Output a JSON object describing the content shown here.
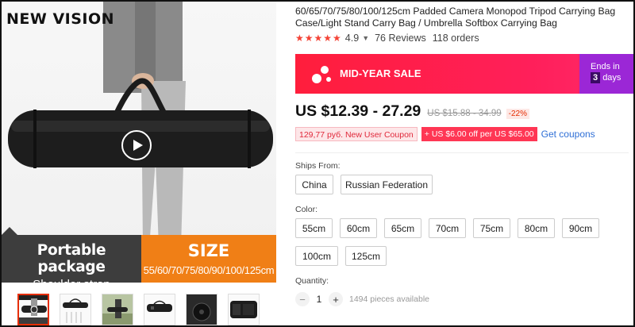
{
  "gallery": {
    "brand": "NEW VISION",
    "banner": {
      "title": "Portable package",
      "subtitle": "Shoulder strap",
      "size_heading": "SIZE",
      "sizes": "55/60/70/75/80/90/100/125cm"
    },
    "thumbnail_count": 6
  },
  "product": {
    "title": "60/65/70/75/80/100/125cm Padded Camera Monopod Tripod Carrying Bag Case/Light Stand Carry Bag / Umbrella Softbox Carrying Bag",
    "rating": {
      "stars": 5,
      "score": "4.9",
      "reviews": "76 Reviews",
      "orders": "118 orders"
    },
    "sale": {
      "label": "MID-YEAR SALE",
      "ends_in": "Ends in",
      "days_count": "3",
      "days_label": "days"
    },
    "price": {
      "current": "US $12.39 - 27.29",
      "original": "US $15.88 - 34.99",
      "discount": "-22%"
    },
    "coupons": {
      "new_user": "129,77 руб. New User Coupon",
      "store": "+ US $6.00 off per US $65.00",
      "get": "Get coupons"
    },
    "ships_from": {
      "label": "Ships From:",
      "options": [
        "China",
        "Russian Federation"
      ]
    },
    "color": {
      "label": "Color:",
      "options": [
        "55cm",
        "60cm",
        "65cm",
        "70cm",
        "75cm",
        "80cm",
        "90cm",
        "100cm",
        "125cm"
      ]
    },
    "quantity": {
      "label": "Quantity:",
      "value": "1",
      "minus": "−",
      "plus": "+",
      "stock": "1494 pieces available"
    },
    "colors": {
      "accent_red": "#e62e04",
      "sale_red": "#ff1e3c",
      "sale_purple": "#9b27d6",
      "banner_orange": "#f07f16",
      "star": "#f44336",
      "link": "#2f6fd6"
    }
  }
}
